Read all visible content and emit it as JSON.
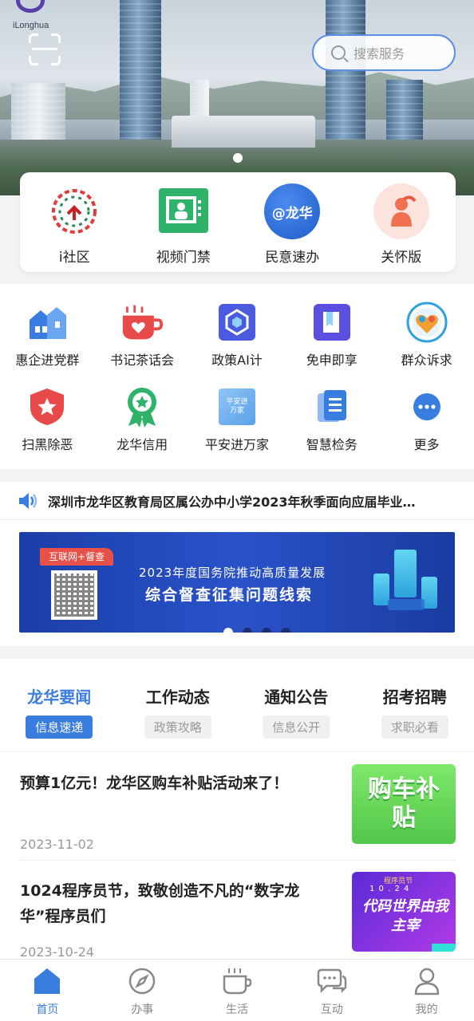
{
  "header": {
    "logo_text": "iLonghua",
    "search_placeholder": "搜索服务"
  },
  "quick_access": [
    {
      "label": "i社区",
      "icon": "community-emblem-icon"
    },
    {
      "label": "视频门禁",
      "icon": "video-access-icon"
    },
    {
      "label": "民意速办",
      "icon": "longhua-mention-icon",
      "icon_text": "@龙华"
    },
    {
      "label": "关怀版",
      "icon": "elder-care-icon"
    }
  ],
  "services_row1": [
    {
      "label": "惠企进党群",
      "icon": "house-flag-icon",
      "color": "#3a7de0"
    },
    {
      "label": "书记茶话会",
      "icon": "tea-cup-heart-icon",
      "color": "#e84a4a"
    },
    {
      "label": "政策AI计",
      "icon": "policy-ai-icon",
      "color": "#4a5be0"
    },
    {
      "label": "免申即享",
      "icon": "book-icon",
      "color": "#4a5be0"
    },
    {
      "label": "群众诉求",
      "icon": "heart-badge-icon",
      "color": "#e8a040"
    }
  ],
  "services_row2": [
    {
      "label": "扫黑除恶",
      "icon": "shield-star-icon",
      "color": "#e84a4a"
    },
    {
      "label": "龙华信用",
      "icon": "credit-medal-icon",
      "color": "#2fb26a"
    },
    {
      "label": "平安进万家",
      "icon": "safety-home-icon",
      "icon_text": "平安进万家",
      "color": "#6aaef0"
    },
    {
      "label": "智慧检务",
      "icon": "document-icon",
      "color": "#3a7de0"
    },
    {
      "label": "更多",
      "icon": "more-icon",
      "color": "#3a7de0"
    }
  ],
  "notice": {
    "text": "深圳市龙华区教育局区属公办中小学2023年秋季面向应届毕业…"
  },
  "banner": {
    "tag": "互联网+督查",
    "line1": "2023年度国务院推动高质量发展",
    "line2": "综合督查征集问题线索",
    "active_slide": 1,
    "slide_count": 4
  },
  "news_tabs": [
    {
      "label": "龙华要闻",
      "sub": "信息速递",
      "active": true
    },
    {
      "label": "工作动态",
      "sub": "政策攻略",
      "active": false
    },
    {
      "label": "通知公告",
      "sub": "信息公开",
      "active": false
    },
    {
      "label": "招考招聘",
      "sub": "求职必看",
      "active": false
    }
  ],
  "news": [
    {
      "title": "预算1亿元！龙华区购车补贴活动来了！",
      "date": "2023-11-02",
      "thumb_text": "购车补贴"
    },
    {
      "title": "1024程序员节，致敬创造不凡的“数字龙华”程序员们",
      "date": "2023-10-24",
      "thumb_top": "程序员节",
      "thumb_digits": "1 0 . 2 4",
      "thumb_text": "代码世界由我主宰"
    }
  ],
  "bottom_nav": [
    {
      "label": "首页",
      "icon": "home-icon",
      "active": true
    },
    {
      "label": "办事",
      "icon": "compass-icon",
      "active": false
    },
    {
      "label": "生活",
      "icon": "coffee-cup-icon",
      "active": false
    },
    {
      "label": "互动",
      "icon": "chat-bubbles-icon",
      "active": false
    },
    {
      "label": "我的",
      "icon": "user-icon",
      "active": false
    }
  ],
  "colors": {
    "primary": "#3a7de0",
    "accent_red": "#e84a4a"
  }
}
